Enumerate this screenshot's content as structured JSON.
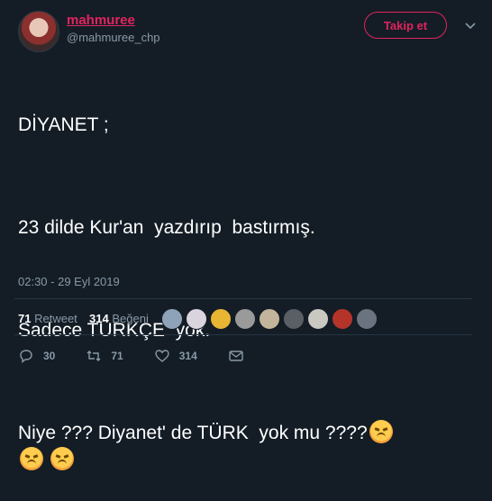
{
  "user": {
    "display_name": "mahmuree",
    "handle": "@mahmuree_chp"
  },
  "follow_button": {
    "label": "Takip et"
  },
  "tweet": {
    "lines": [
      "DİYANET ;",
      "23 dilde Kur'an  yazdırıp  bastırmış.",
      "Sadece TÜRKÇE  yok.",
      "Niye ??? Diyanet' de TÜRK  yok mu ????"
    ],
    "emoji": "angry-face"
  },
  "timestamp": "02:30 - 29 Eyl 2019",
  "stats": {
    "retweets_count": "71",
    "retweets_label": "Retweet",
    "likes_count": "314",
    "likes_label": "Beğeni"
  },
  "actions": {
    "reply_count": "30",
    "retweet_count": "71",
    "like_count": "314"
  },
  "colors": {
    "background": "#141d26",
    "accent": "#e0245e",
    "muted": "#8899a6"
  }
}
